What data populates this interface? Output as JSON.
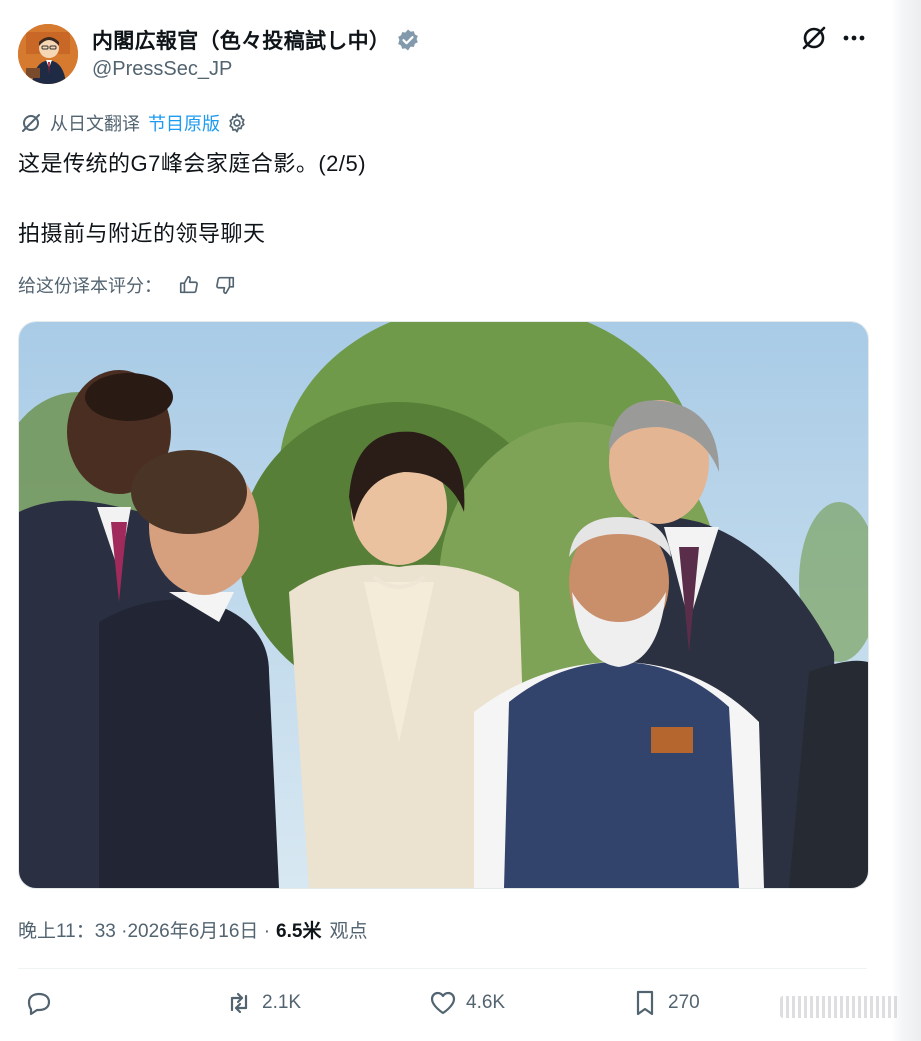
{
  "author": {
    "display_name": "内閣広報官（色々投稿試し中）",
    "handle": "@PressSec_JP"
  },
  "translation": {
    "prefix": "从日文翻译",
    "link": "节目原版"
  },
  "tweet": {
    "line1": "这是传统的G7峰会家庭合影。(2/5)",
    "line2": "拍摄前与附近的领导聊天"
  },
  "rating": {
    "prompt": "给这份译本评分："
  },
  "meta": {
    "timestamp": "晚上11：33 ·2026年6月16日 ·",
    "views_count": "6.5米",
    "views_label": "观点"
  },
  "actions": {
    "retweets": "2.1K",
    "likes": "4.6K",
    "bookmarks": "270"
  },
  "colors": {
    "accent": "#1d9bf0",
    "secondary_text": "#536471",
    "verified_badge": "#829aab"
  },
  "icons": [
    "grok-icon",
    "more-icon",
    "translate-icon",
    "gear-icon",
    "thumbs-up-icon",
    "thumbs-down-icon",
    "reply-icon",
    "retweet-icon",
    "heart-icon",
    "bookmark-icon",
    "verified-badge-icon"
  ]
}
